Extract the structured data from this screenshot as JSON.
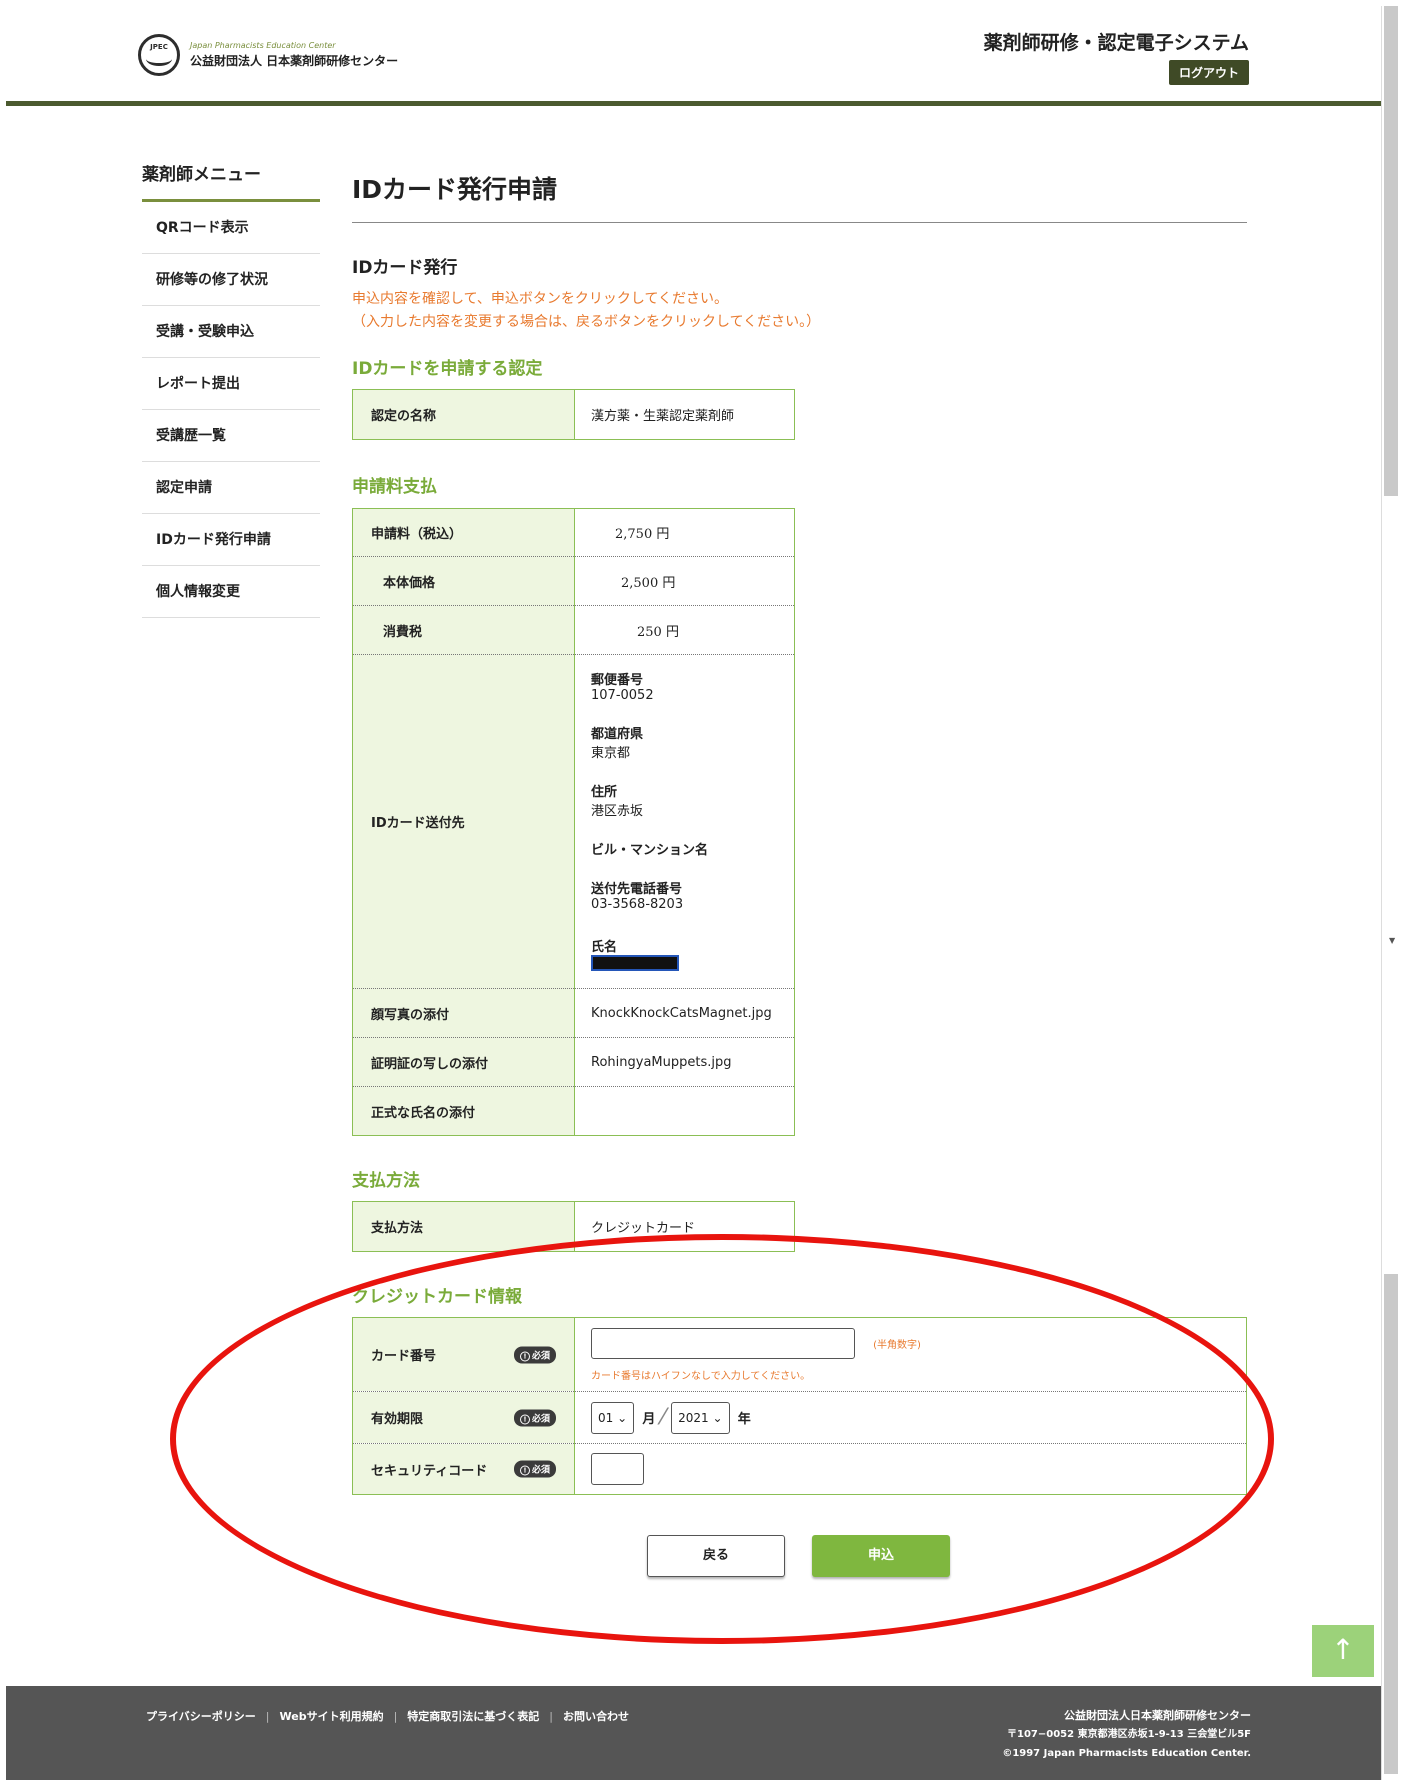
{
  "header": {
    "logo_mark_text": "JPEC",
    "logo_en": "Japan Pharmacists Education Center",
    "logo_jp": "公益財団法人 日本薬剤師研修センター",
    "system_title": "薬剤師研修・認定電子システム",
    "logout_label": "ログアウト"
  },
  "sidebar": {
    "title": "薬剤師メニュー",
    "items": [
      {
        "label": "QRコード表示"
      },
      {
        "label": "研修等の修了状況"
      },
      {
        "label": "受講・受験申込"
      },
      {
        "label": "レポート提出"
      },
      {
        "label": "受講歴一覧"
      },
      {
        "label": "認定申請"
      },
      {
        "label": "IDカード発行申請"
      },
      {
        "label": "個人情報変更"
      }
    ]
  },
  "main": {
    "page_title": "IDカード発行申請",
    "section_title": "IDカード発行",
    "notice_line1": "申込内容を確認して、申込ボタンをクリックしてください。",
    "notice_line2": "（入力した内容を変更する場合は、戻るボタンをクリックしてください。）",
    "cert": {
      "heading": "IDカードを申請する認定",
      "name_label": "認定の名称",
      "name_value": "漢方薬・生薬認定薬剤師"
    },
    "fee": {
      "heading": "申請料支払",
      "total_label": "申請料（税込）",
      "total_value": "2,750 円",
      "base_label": "本体価格",
      "base_value": "2,500 円",
      "tax_label": "消費税",
      "tax_value": "250 円",
      "dest_label": "IDカード送付先",
      "postal_label": "郵便番号",
      "postal_value": "107-0052",
      "pref_label": "都道府県",
      "pref_value": "東京都",
      "addr_label": "住所",
      "addr_value": "港区赤坂",
      "building_label": "ビル・マンション名",
      "building_value": "",
      "phone_label": "送付先電話番号",
      "phone_value": "03-3568-8203",
      "name_label": "氏名",
      "photo_label": "顔写真の添付",
      "photo_value": "KnockKnockCatsMagnet.jpg",
      "cert_copy_label": "証明証の写しの添付",
      "cert_copy_value": "RohingyaMuppets.jpg",
      "official_name_label": "正式な氏名の添付",
      "official_name_value": ""
    },
    "payment": {
      "heading": "支払方法",
      "method_label": "支払方法",
      "method_value": "クレジットカード"
    },
    "credit": {
      "heading": "クレジットカード情報",
      "required_label": "必須",
      "card_number_label": "カード番号",
      "card_number_hint": "(半角数字)",
      "card_number_note": "カード番号はハイフンなしで入力してください。",
      "expiry_label": "有効期限",
      "expiry_month": "01",
      "month_unit": "月",
      "expiry_year": "2021",
      "year_unit": "年",
      "security_label": "セキュリティコード"
    },
    "back_label": "戻る",
    "apply_label": "申込"
  },
  "footer": {
    "links": [
      {
        "label": "プライバシーポリシー"
      },
      {
        "label": "Webサイト利用規約"
      },
      {
        "label": "特定商取引法に基づく表記"
      },
      {
        "label": "お問い合わせ"
      }
    ],
    "org_name": "公益財団法人日本薬剤師研修センター",
    "address": "〒107−0052 東京都港区赤坂1-9-13 三会堂ビル5F",
    "copyright": "©1997 Japan Pharmacists Education Center."
  },
  "colors": {
    "accent_green": "#7aab3a",
    "header_rule": "#4b5a2f",
    "notice_orange": "#e87a2f",
    "annotation_red": "#e8140e",
    "footer_bg": "#555555"
  },
  "icons": [
    "jpec-logo-icon",
    "info-required-icon",
    "chevron-down-icon",
    "arrow-up-icon"
  ]
}
